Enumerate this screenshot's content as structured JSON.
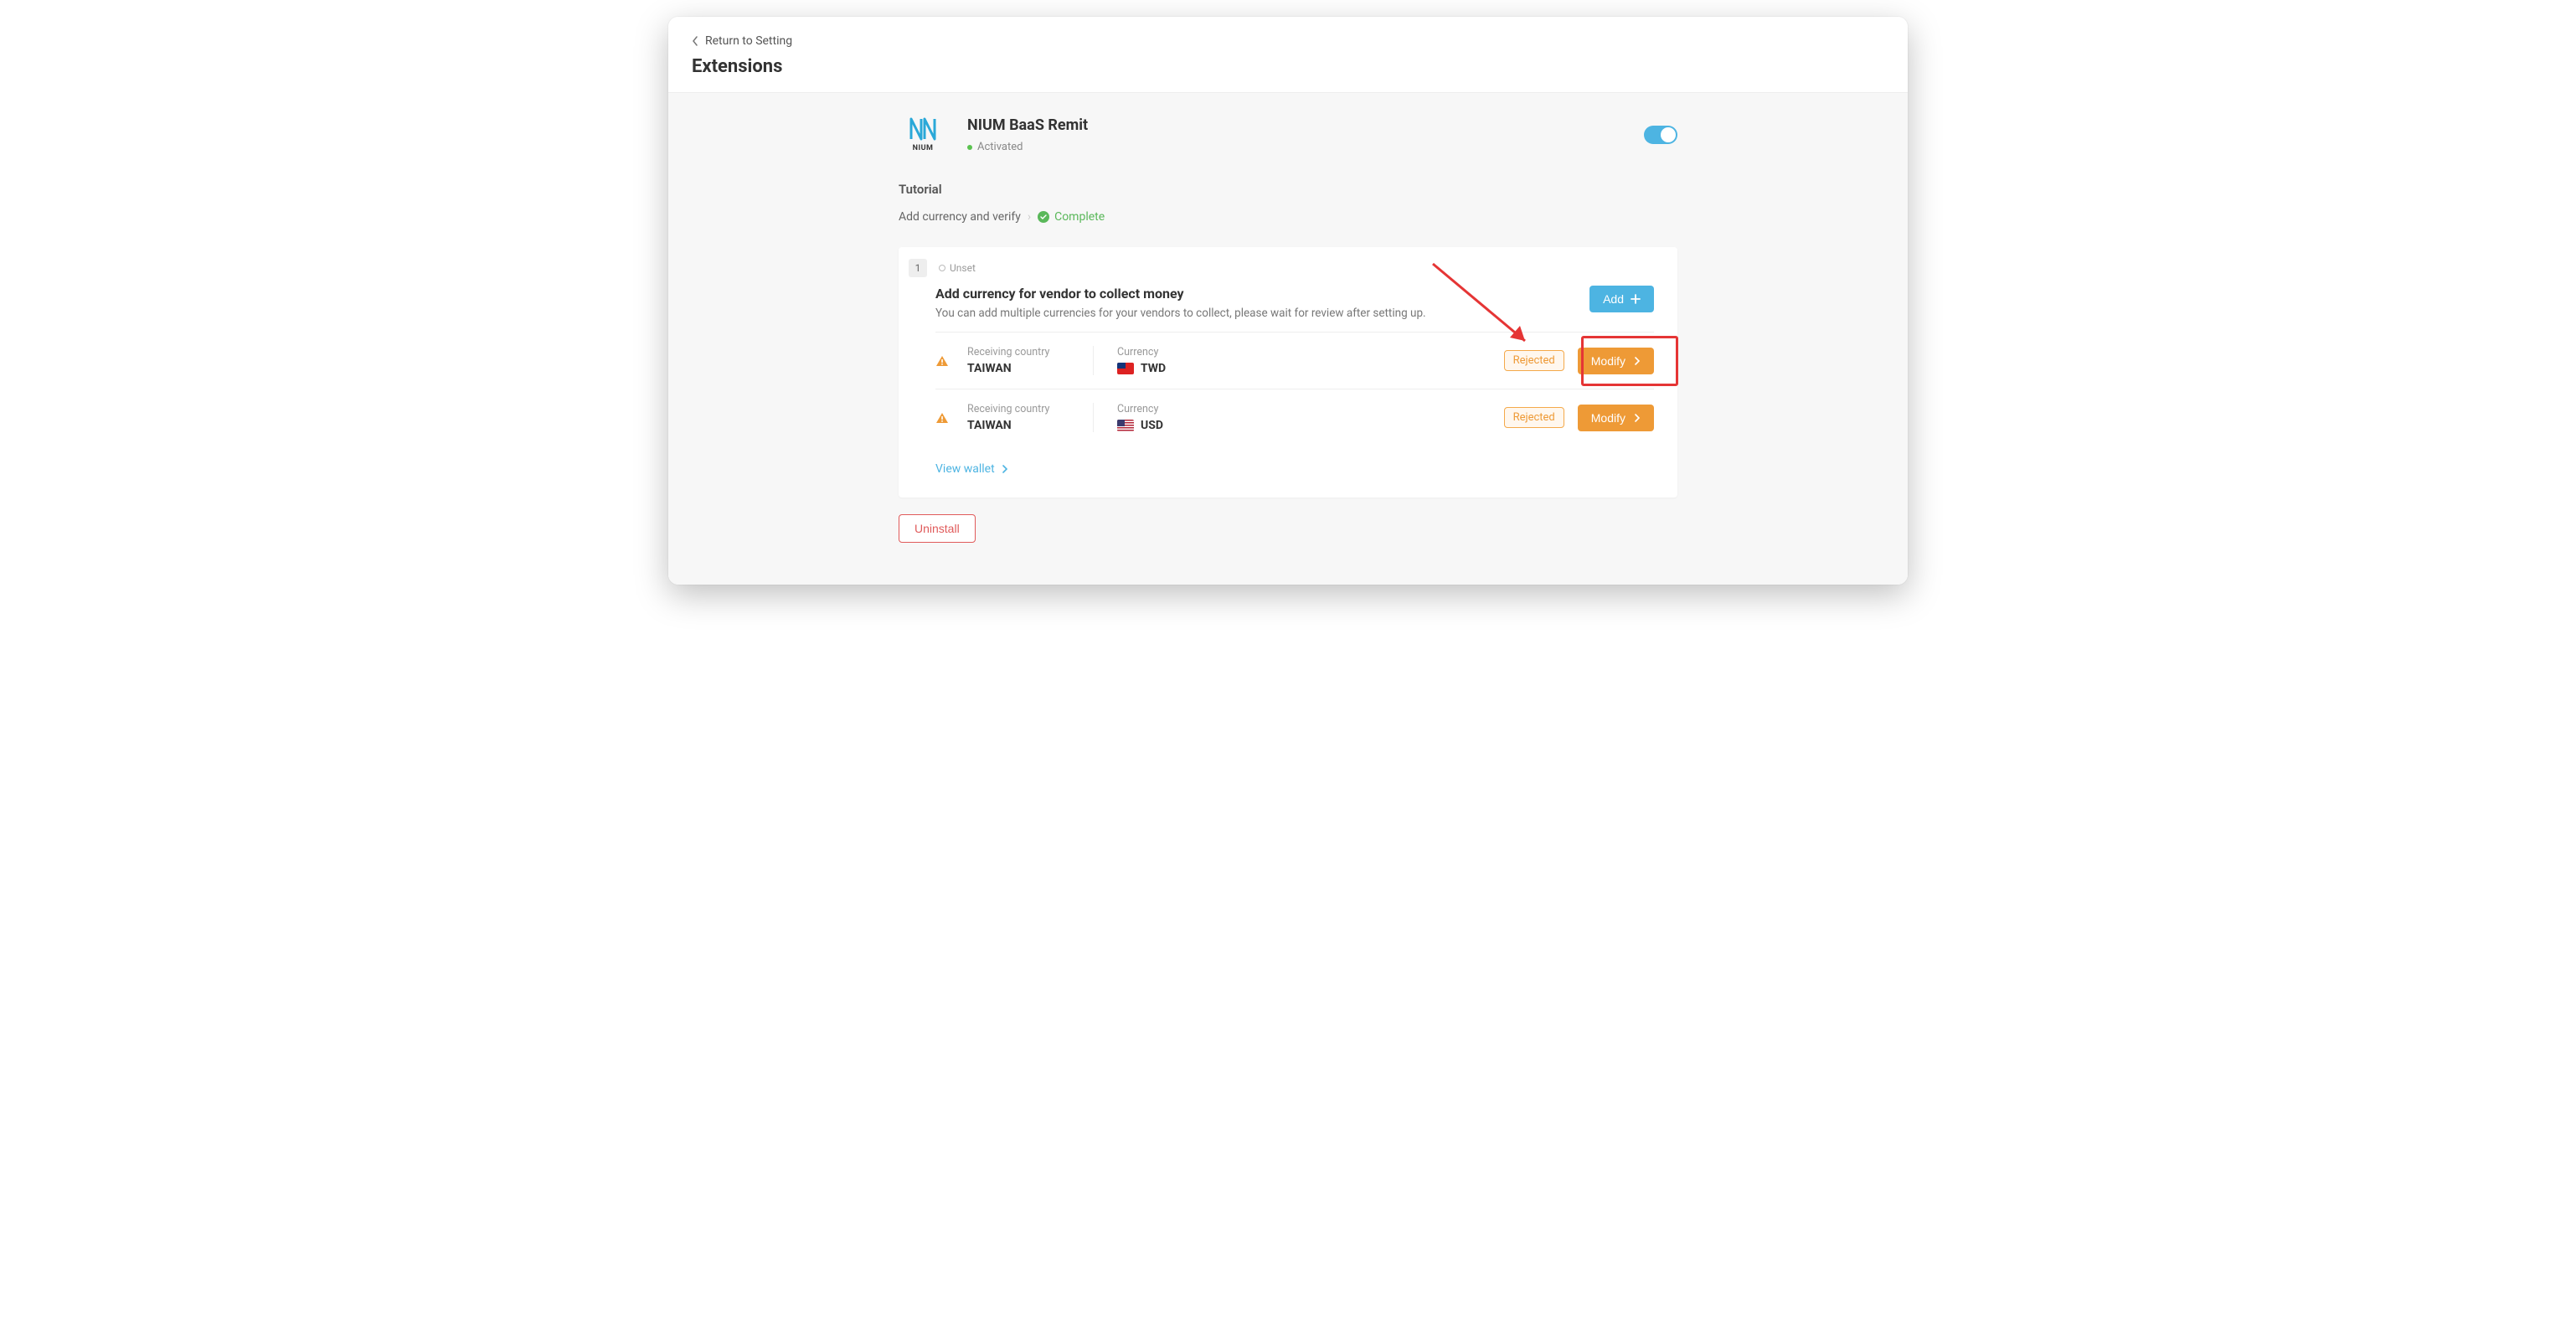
{
  "header": {
    "return_label": "Return to Setting",
    "page_title": "Extensions"
  },
  "extension": {
    "logo_text": "NIUM",
    "name": "NIUM BaaS Remit",
    "status_label": "Activated"
  },
  "tutorial": {
    "section_label": "Tutorial",
    "breadcrumb_step": "Add currency and verify",
    "breadcrumb_complete": "Complete"
  },
  "step": {
    "number": "1",
    "status": "Unset",
    "title": "Add currency for vendor to collect money",
    "description": "You can add multiple currencies for your vendors to collect, please wait for review after setting up.",
    "add_label": "Add"
  },
  "rows": [
    {
      "country_label": "Receiving country",
      "country_value": "TAIWAN",
      "currency_label": "Currency",
      "currency_value": "TWD",
      "flag": "tw",
      "status_badge": "Rejected",
      "modify_label": "Modify"
    },
    {
      "country_label": "Receiving country",
      "country_value": "TAIWAN",
      "currency_label": "Currency",
      "currency_value": "USD",
      "flag": "us",
      "status_badge": "Rejected",
      "modify_label": "Modify"
    }
  ],
  "footer": {
    "view_wallet": "View wallet",
    "uninstall": "Uninstall"
  }
}
